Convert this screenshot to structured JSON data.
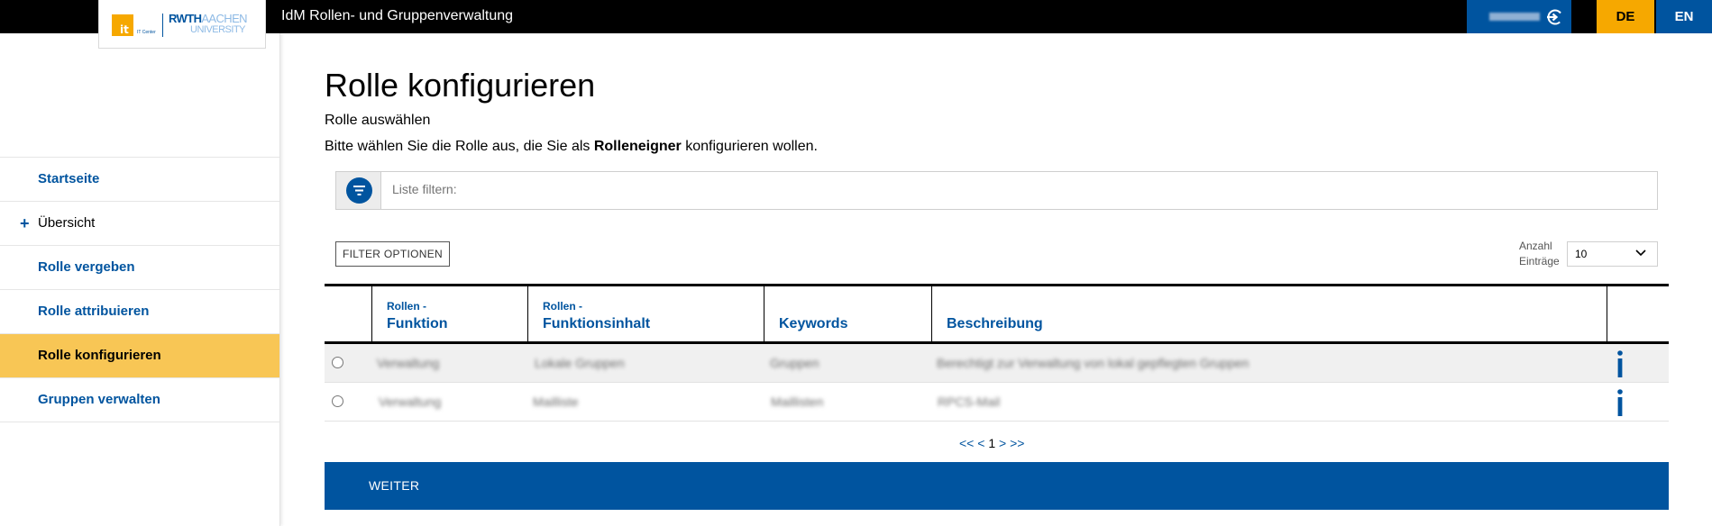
{
  "header": {
    "app_title": "IdM Rollen- und Gruppenverwaltung",
    "logo": {
      "it_mark": "it",
      "it_center": "IT Center",
      "rwth": "RWTH",
      "aachen": "AACHEN",
      "university": "UNIVERSITY"
    },
    "user_button_icon": "login-icon",
    "lang_de": "DE",
    "lang_en": "EN",
    "colors": {
      "bar": "#000000",
      "accent_blue": "#00549f",
      "accent_yellow": "#f6a800"
    }
  },
  "sidebar": {
    "items": [
      {
        "label": "Startseite",
        "prefix": ""
      },
      {
        "label": "Übersicht",
        "prefix": "+"
      },
      {
        "label": "Rolle vergeben",
        "prefix": ""
      },
      {
        "label": "Rolle attribuieren",
        "prefix": ""
      },
      {
        "label": "Rolle konfigurieren",
        "prefix": "",
        "active": true
      },
      {
        "label": "Gruppen verwalten",
        "prefix": ""
      }
    ]
  },
  "main": {
    "title": "Rolle konfigurieren",
    "subtitle": "Rolle auswählen",
    "description_before": "Bitte wählen Sie die Rolle aus, die Sie als ",
    "description_bold": "Rolleneigner",
    "description_after": " konfigurieren wollen.",
    "filter": {
      "placeholder": "Liste filtern:",
      "icon": "filter-icon"
    },
    "filter_options_label": "FILTER OPTIONEN",
    "entries": {
      "label_line1": "Anzahl",
      "label_line2": "Einträge",
      "selected": "10"
    },
    "table": {
      "columns": [
        {
          "small": "Rollen -",
          "big": "Funktion"
        },
        {
          "small": "Rollen -",
          "big": "Funktionsinhalt"
        },
        {
          "small": "",
          "big": "Keywords"
        },
        {
          "small": "",
          "big": "Beschreibung"
        }
      ],
      "rows": [
        {
          "funktion": "Verwaltung",
          "inhalt": "Lokale Gruppen",
          "keywords": "Gruppen",
          "beschreibung": "Berechtigt zur Verwaltung von lokal gepflegten Gruppen"
        },
        {
          "funktion": "Verwaltung",
          "inhalt": "Mailliste",
          "keywords": "Maillisten",
          "beschreibung": "RPCS-Mail"
        }
      ]
    },
    "pager": {
      "first": "<<",
      "prev": "<",
      "current": "1",
      "next": ">",
      "last": ">>"
    },
    "next_button": "WEITER"
  }
}
